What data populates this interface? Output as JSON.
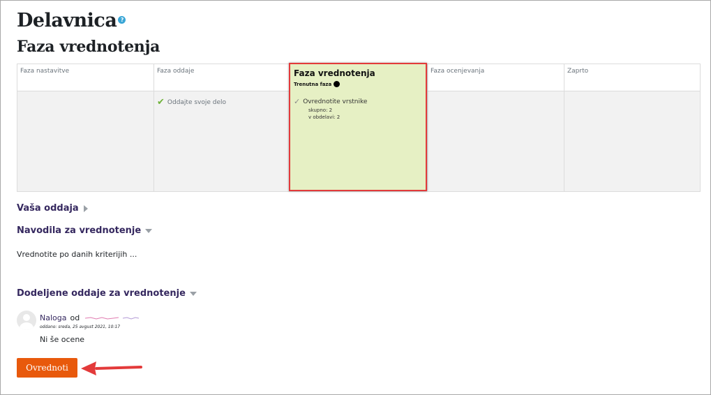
{
  "page": {
    "title": "Delavnica",
    "subtitle": "Faza vrednotenja"
  },
  "colors": {
    "accent": "#35285f",
    "button": "#e8590c",
    "active_phase_bg": "#e6f0c4",
    "highlight": "#e33a3a"
  },
  "phases": [
    {
      "name": "Faza nastavitve"
    },
    {
      "name": "Faza oddaje",
      "task": "Oddajte svoje delo"
    },
    {
      "name": "Faza vrednotenja",
      "current_label": "Trenutna faza",
      "task": "Ovrednotite vrstnike",
      "stats": [
        "skupno: 2",
        "v obdelavi: 2"
      ]
    },
    {
      "name": "Faza ocenjevanja"
    },
    {
      "name": "Zaprto"
    }
  ],
  "sections": {
    "your_submission": "Vaša oddaja",
    "instructions": "Navodila za vrednotenje",
    "instructions_text": "Vrednotite po danih kriterijih ...",
    "allocated": "Dodeljene oddaje za vrednotenje"
  },
  "submission": {
    "link": "Naloga",
    "by": "od",
    "date": "oddano: sreda, 25 avgust 2021, 10:17",
    "grade": "Ni še ocene"
  },
  "buttons": {
    "assess": "Ovrednoti"
  },
  "icons": {
    "help": "help-icon",
    "check": "check-icon",
    "current": "dot-icon",
    "collapsed": "triangle-right-icon",
    "expanded": "triangle-down-icon",
    "pointer": "arrow-icon"
  }
}
